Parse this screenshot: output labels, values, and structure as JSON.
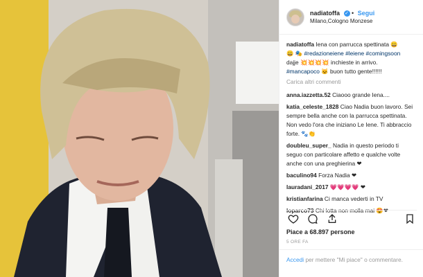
{
  "post": {
    "author": "nadiatoffa",
    "verified_mark": "✓",
    "follow_label": "Segui",
    "separator": "•",
    "location": "Milano,Cologno Monzese"
  },
  "caption": {
    "username": "nadiatoffa",
    "line1": " Iena con parrucca spettinata 😀",
    "line2_prefix": "😀 🎭 ",
    "tags": [
      "#redazioneiene",
      "#leiene",
      "#comingsoon"
    ],
    "line3": "dajje 💥💥💥💥 inchieste in arrivo.",
    "tag_last": "#mancapoco",
    "line4_suffix": " 🐱 buon tutto gente!!!!!!"
  },
  "load_more_label": "Carica altri commenti",
  "comments": [
    {
      "user": "anna.iazzetta.52",
      "text": " Ciaooo grande Iena...."
    },
    {
      "user": "katia_celeste_1828",
      "text": " Ciao Nadia buon lavoro. Sei sempre bella anche con la parrucca spettinata. Non vedo l'ora che iniziano Le Iene. Ti abbraccio forte. 🐾👏"
    },
    {
      "user": "doubleu_super_",
      "text": " Nadia in questo periodo ti seguo con particolare affetto e qualche volte anche con una preghierina ❤"
    },
    {
      "user": "baculino94",
      "text": " Forza Nadia ❤"
    },
    {
      "user": "lauradani_2017",
      "text": " 💗💗💗💗 ❤"
    },
    {
      "user": "kristianfarina",
      "text": " Ci manca vederti in TV"
    },
    {
      "user": "loparco73",
      "text": " Chi lotta non molla mai 😍❤"
    }
  ],
  "icons": {
    "like": "heart-icon",
    "comment": "comment-icon",
    "share": "share-icon",
    "save": "bookmark-icon"
  },
  "likes_text": "Piace a 68.897 persone",
  "time_text": "5 ORE FA",
  "add_comment": {
    "link": "Accedi",
    "rest": " per mettere \"Mi piace\" o commentare."
  }
}
